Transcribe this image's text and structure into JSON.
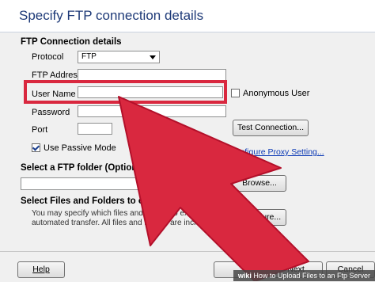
{
  "header": {
    "title": "Specify FTP connection details"
  },
  "ftp": {
    "section_title": "FTP Connection details",
    "protocol_label": "Protocol",
    "protocol_value": "FTP",
    "address_label": "FTP Address",
    "username_label": "User Name",
    "anonymous_label": "Anonymous User",
    "password_label": "Password",
    "port_label": "Port",
    "test_button": "Test Connection...",
    "passive_label": "Use Passive Mode",
    "passive_checked": true,
    "proxy_link": "Configure Proxy Setting..."
  },
  "folder": {
    "section_title": "Select a FTP folder (Optional)",
    "browse_button": "Browse..."
  },
  "exclude": {
    "section_title": "Select Files and Folders to exclude (Optional)",
    "desc_line1": "You may specify which files and folders to exclude during the",
    "desc_line2": "automated transfer. All files and folders are included by default.",
    "configure_button": "Configure..."
  },
  "footer": {
    "help_button": "Help",
    "next_button": "Next",
    "cancel_button": "Cancel"
  },
  "watermark": {
    "site": "wiki",
    "text": "How to Upload Files to an Ftp Server"
  },
  "colors": {
    "highlight": "#d9283f",
    "arrow": "#d9283f",
    "title": "#1e3a78",
    "link": "#0b39b5"
  }
}
